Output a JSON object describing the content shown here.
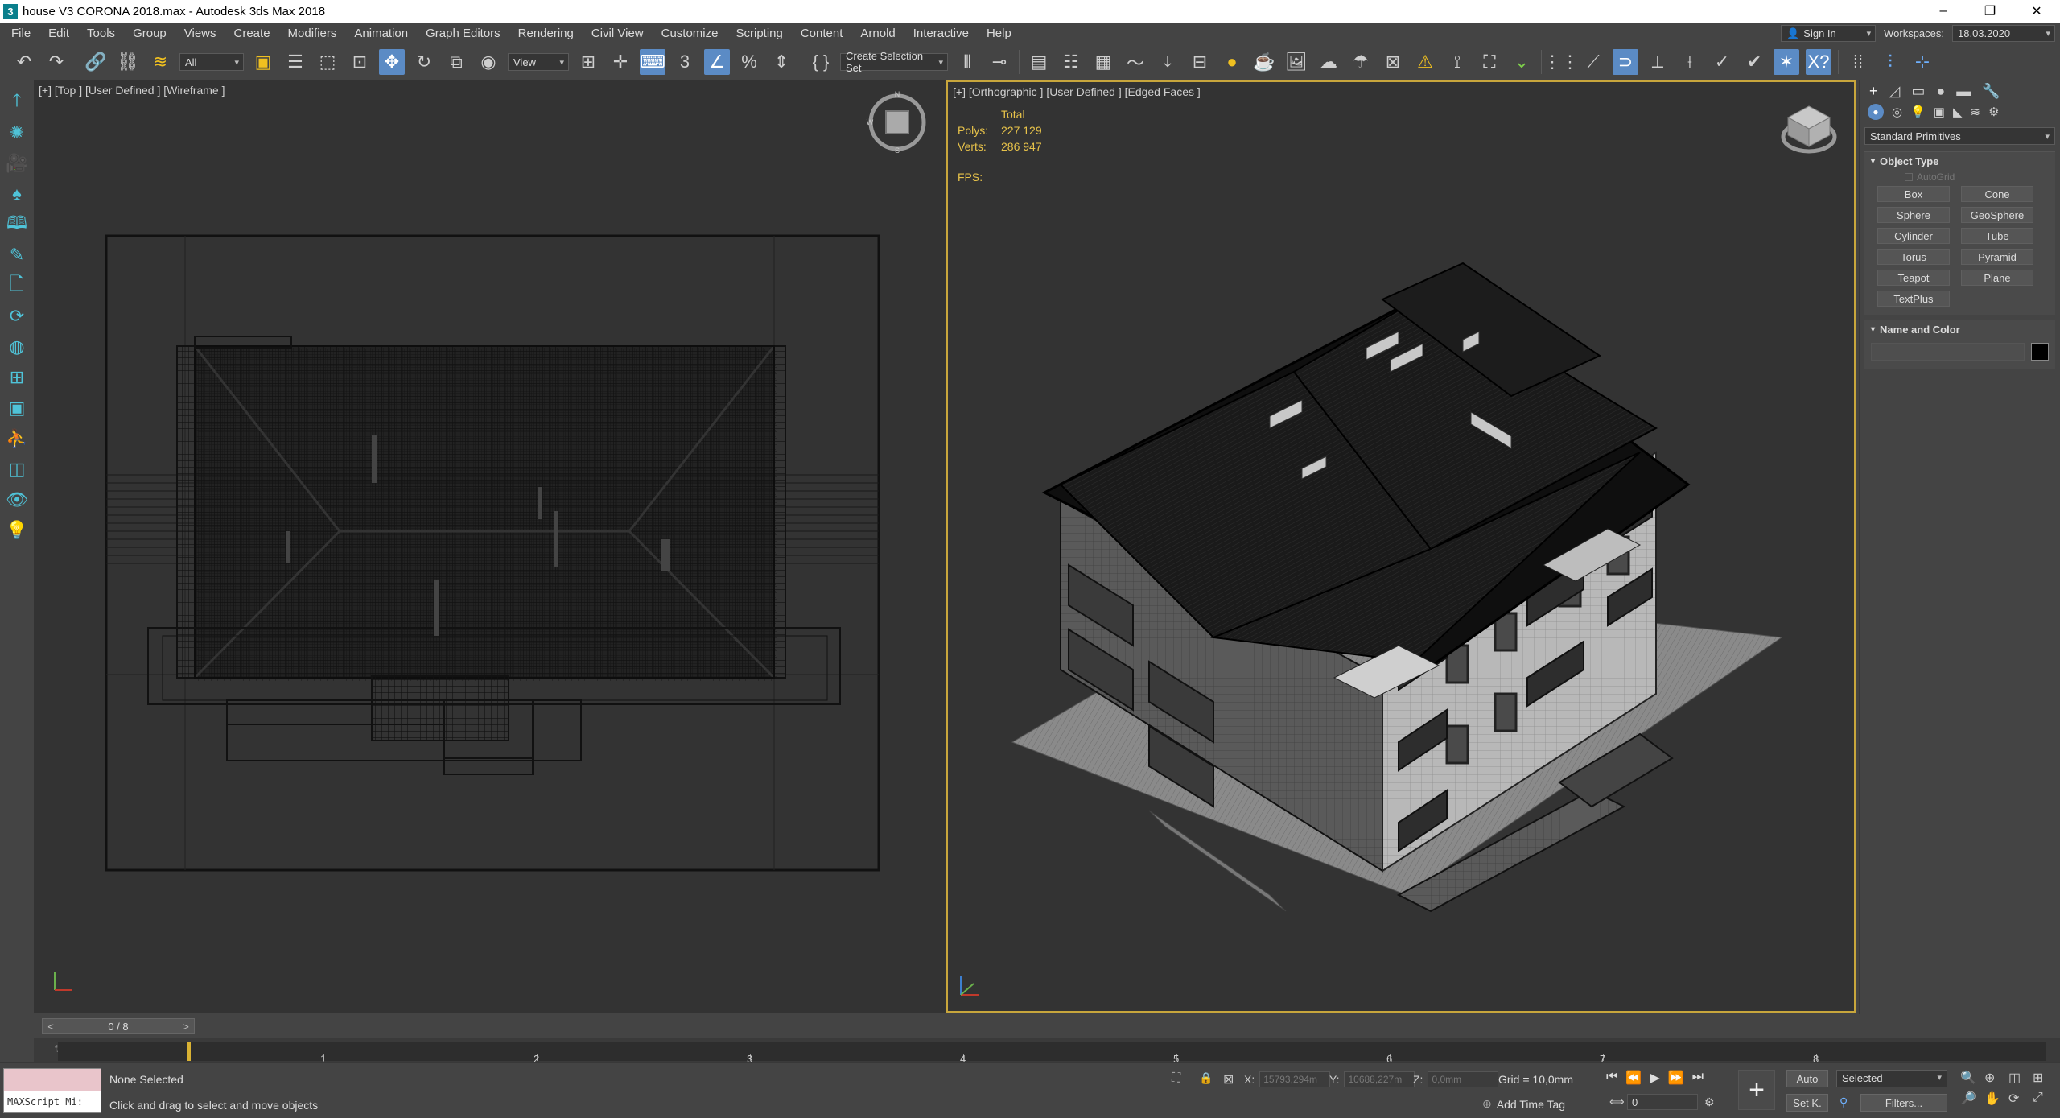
{
  "window": {
    "title": "house V3 CORONA 2018.max - Autodesk 3ds Max 2018",
    "controls": [
      "–",
      "❐",
      "✕"
    ]
  },
  "menu": {
    "items": [
      "File",
      "Edit",
      "Tools",
      "Group",
      "Views",
      "Create",
      "Modifiers",
      "Animation",
      "Graph Editors",
      "Rendering",
      "Civil View",
      "Customize",
      "Scripting",
      "Content",
      "Arnold",
      "Interactive",
      "Help"
    ],
    "signin": "Sign In",
    "workspaces_label": "Workspaces:",
    "workspace_value": "18.03.2020"
  },
  "toolbar": {
    "filter_value": "All",
    "refcoord_value": "View",
    "selection_set_placeholder": "Create Selection Set"
  },
  "viewports": {
    "left_label": "[+] [Top ] [User Defined ] [Wireframe ]",
    "right_label": "[+] [Orthographic ] [User Defined ] [Edged Faces ]",
    "stats": {
      "header": "Total",
      "polys_label": "Polys:",
      "polys_value": "227 129",
      "verts_label": "Verts:",
      "verts_value": "286 947",
      "fps_label": "FPS:"
    }
  },
  "command_panel": {
    "category": "Standard Primitives",
    "object_type_title": "Object Type",
    "autogrid_label": "AutoGrid",
    "primitives": [
      "Box",
      "Cone",
      "Sphere",
      "GeoSphere",
      "Cylinder",
      "Tube",
      "Torus",
      "Pyramid",
      "Teapot",
      "Plane",
      "TextPlus"
    ],
    "name_color_title": "Name and Color"
  },
  "timeline": {
    "slider_value": "0 / 8",
    "ticks": [
      "1",
      "2",
      "3",
      "4",
      "5",
      "6",
      "7",
      "8"
    ]
  },
  "status": {
    "maxscript_label": "MAXScript Mi:",
    "selection_text": "None Selected",
    "prompt_text": "Click and drag to select and move objects",
    "x_label": "X:",
    "x_value": "15793,294m",
    "y_label": "Y:",
    "y_value": "10688,227m",
    "z_label": "Z:",
    "z_value": "0,0mm",
    "grid_text": "Grid = 10,0mm",
    "add_time_tag": "Add Time Tag",
    "auto_key": "Auto",
    "set_key": "Set K.",
    "key_filter_value": "Selected",
    "filters_label": "Filters...",
    "frame_value": "0"
  }
}
